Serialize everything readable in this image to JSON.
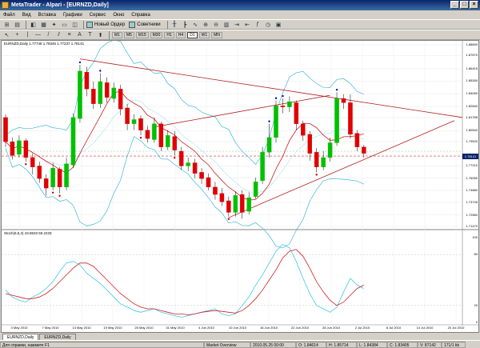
{
  "window": {
    "title": "MetaTrader - Alpari - [EURNZD,Daily]",
    "buttons": [
      "_",
      "□",
      "×"
    ]
  },
  "menu": [
    "Файл",
    "Вид",
    "Вставка",
    "Графики",
    "Сервис",
    "Окно",
    "Справка"
  ],
  "toolbar": {
    "new_order": "Новый Ордер",
    "advisors": "Советники",
    "timeframes": [
      "M1",
      "M5",
      "M15",
      "M30",
      "H1",
      "H4",
      "D1",
      "W1",
      "MN"
    ],
    "active_timeframe": "D1"
  },
  "chart": {
    "symbol_label": "EURNZD,Daily  1.77748 1.78346 1.77237 1.78141",
    "stoch_label": "Stoch(8,5,3) 43.8633 50.2233",
    "price_labels": [
      "1.88690",
      "1.87670",
      "1.86415",
      "1.85260",
      "1.84050",
      "1.82840",
      "1.81785",
      "1.80540",
      "1.79520",
      "1.78141",
      "1.77210",
      "1.76050",
      "1.74880",
      "1.73745",
      "1.72560",
      "1.71470"
    ],
    "current_price": "1.78141",
    "stoch_levels": [
      "100",
      "80",
      "20",
      "0"
    ],
    "dates": [
      "3 May 2010",
      "7 May 2010",
      "13 May 2010",
      "19 May 2010",
      "25 May 2010",
      "31 May 2010",
      "4 Jun 2010",
      "10 Jun 2010",
      "16 Jun 2010",
      "22 Jun 2010",
      "28 Jun 2010",
      "2 Jul 2010",
      "8 Jul 2010",
      "14 Jul 2010",
      "20 Jul 2010"
    ],
    "bull_color": "#00c000",
    "bear_color": "#e00000",
    "candles": [
      [
        1.818,
        1.795,
        1.821,
        1.79
      ],
      [
        1.795,
        1.782,
        1.799,
        1.778
      ],
      [
        1.783,
        1.796,
        1.801,
        1.78
      ],
      [
        1.796,
        1.78,
        1.798,
        1.776
      ],
      [
        1.78,
        1.771,
        1.784,
        1.764
      ],
      [
        1.772,
        1.76,
        1.776,
        1.756
      ],
      [
        1.76,
        1.751,
        1.764,
        1.744
      ],
      [
        1.752,
        1.77,
        1.775,
        1.749
      ],
      [
        1.769,
        1.752,
        1.771,
        1.746
      ],
      [
        1.752,
        1.774,
        1.78,
        1.749
      ],
      [
        1.773,
        1.818,
        1.822,
        1.77
      ],
      [
        1.817,
        1.862,
        1.868,
        1.813
      ],
      [
        1.861,
        1.845,
        1.866,
        1.838
      ],
      [
        1.845,
        1.831,
        1.852,
        1.826
      ],
      [
        1.831,
        1.852,
        1.86,
        1.827
      ],
      [
        1.851,
        1.837,
        1.856,
        1.832
      ],
      [
        1.836,
        1.846,
        1.851,
        1.832
      ],
      [
        1.845,
        1.826,
        1.849,
        1.82
      ],
      [
        1.827,
        1.812,
        1.831,
        1.806
      ],
      [
        1.812,
        1.816,
        1.821,
        1.806
      ],
      [
        1.817,
        1.806,
        1.82,
        1.801
      ],
      [
        1.806,
        1.798,
        1.81,
        1.794
      ],
      [
        1.797,
        1.812,
        1.818,
        1.794
      ],
      [
        1.812,
        1.79,
        1.814,
        1.786
      ],
      [
        1.79,
        1.801,
        1.806,
        1.787
      ],
      [
        1.8,
        1.787,
        1.805,
        1.782
      ],
      [
        1.786,
        1.772,
        1.79,
        1.768
      ],
      [
        1.772,
        1.775,
        1.78,
        1.767
      ],
      [
        1.775,
        1.765,
        1.779,
        1.76
      ],
      [
        1.766,
        1.76,
        1.77,
        1.755
      ],
      [
        1.761,
        1.752,
        1.765,
        1.749
      ],
      [
        1.752,
        1.745,
        1.757,
        1.74
      ],
      [
        1.746,
        1.738,
        1.751,
        1.734
      ],
      [
        1.739,
        1.728,
        1.743,
        1.724
      ],
      [
        1.728,
        1.744,
        1.748,
        1.724
      ],
      [
        1.745,
        1.728,
        1.749,
        1.722
      ],
      [
        1.729,
        1.742,
        1.747,
        1.726
      ],
      [
        1.743,
        1.757,
        1.761,
        1.741
      ],
      [
        1.758,
        1.785,
        1.79,
        1.755
      ],
      [
        1.785,
        1.799,
        1.812,
        1.78
      ],
      [
        1.799,
        1.829,
        1.834,
        1.794
      ],
      [
        1.829,
        1.828,
        1.836,
        1.822
      ],
      [
        1.828,
        1.833,
        1.838,
        1.823
      ],
      [
        1.832,
        1.812,
        1.834,
        1.806
      ],
      [
        1.812,
        1.801,
        1.815,
        1.796
      ],
      [
        1.802,
        1.784,
        1.805,
        1.777
      ],
      [
        1.785,
        1.771,
        1.789,
        1.766
      ],
      [
        1.771,
        1.78,
        1.786,
        1.768
      ],
      [
        1.78,
        1.794,
        1.799,
        1.776
      ],
      [
        1.794,
        1.836,
        1.842,
        1.791
      ],
      [
        1.836,
        1.832,
        1.84,
        1.826
      ],
      [
        1.832,
        1.802,
        1.84,
        1.798
      ],
      [
        1.803,
        1.79,
        1.806,
        1.786
      ],
      [
        1.79,
        1.784,
        1.792,
        1.78
      ]
    ],
    "stoch_main": [
      38,
      30,
      26,
      24,
      30,
      34,
      40,
      48,
      60,
      70,
      72,
      68,
      58,
      52,
      46,
      38,
      30,
      22,
      18,
      14,
      12,
      14,
      16,
      12,
      10,
      8,
      6,
      8,
      10,
      12,
      14,
      16,
      10,
      8,
      10,
      20,
      30,
      44,
      56,
      70,
      84,
      92,
      88,
      72,
      52,
      34,
      20,
      16,
      12,
      18,
      36,
      52,
      44,
      40
    ],
    "stoch_signal": [
      34,
      32,
      30,
      28,
      28,
      30,
      34,
      40,
      48,
      56,
      64,
      70,
      70,
      66,
      58,
      50,
      42,
      34,
      28,
      22,
      18,
      16,
      16,
      14,
      12,
      10,
      10,
      9,
      10,
      12,
      13,
      14,
      13,
      12,
      11,
      14,
      20,
      28,
      38,
      50,
      62,
      76,
      84,
      86,
      78,
      64,
      48,
      36,
      26,
      20,
      24,
      32,
      40,
      44
    ]
  },
  "tabs": [
    "EURNZD,Daily",
    "EURNZD,Daily"
  ],
  "status": [
    "Для справки, нажмите F1",
    "Market Overview",
    "2010.05.25 00:00",
    "O: 1.84614",
    "H: 1.85714",
    "L: 1.84384",
    "C: 1.83405",
    "V: 87142",
    "171/1 kb"
  ]
}
